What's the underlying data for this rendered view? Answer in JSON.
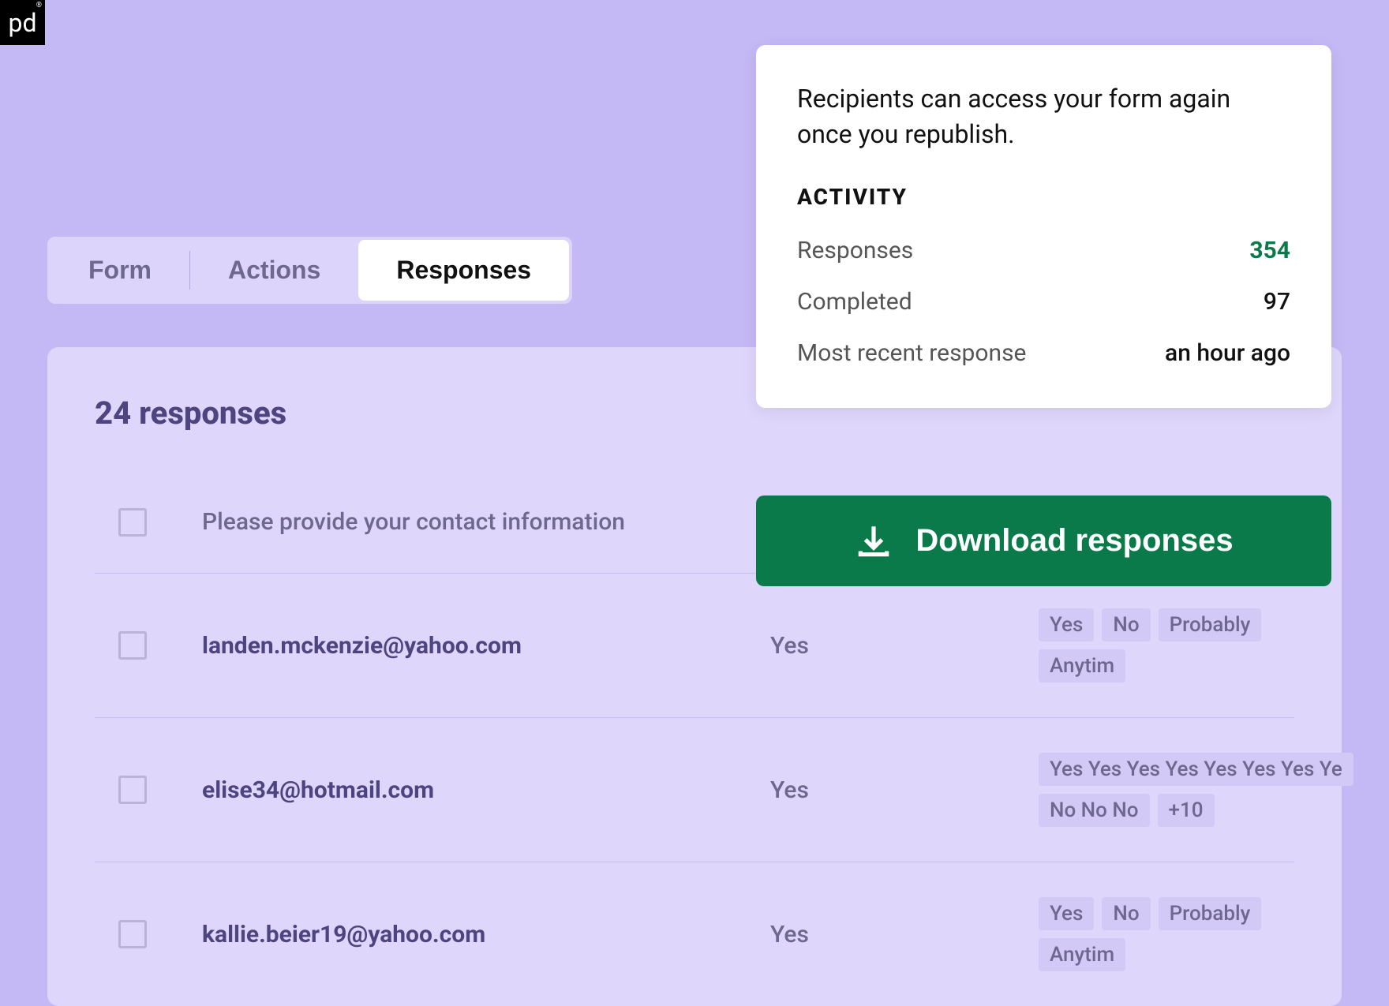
{
  "logo": "pd",
  "tabs": {
    "form": "Form",
    "actions": "Actions",
    "responses": "Responses"
  },
  "content": {
    "title": "24 responses",
    "header_text": "Please provide your contact information",
    "rows": [
      {
        "email": "landen.mckenzie@yahoo.com",
        "answer": "Yes",
        "tags": [
          "Yes",
          "No",
          "Probably",
          "Anytim"
        ]
      },
      {
        "email": "elise34@hotmail.com",
        "answer": "Yes",
        "tags": [
          "Yes Yes Yes Yes Yes Yes Yes Ye",
          "No No No",
          "+10"
        ]
      },
      {
        "email": "kallie.beier19@yahoo.com",
        "answer": "Yes",
        "tags": [
          "Yes",
          "No",
          "Probably",
          "Anytim"
        ]
      }
    ]
  },
  "activity_card": {
    "description": "Recipients can access your form again once you republish.",
    "heading": "ACTIVITY",
    "stats": [
      {
        "label": "Responses",
        "value": "354",
        "green": true
      },
      {
        "label": "Completed",
        "value": "97",
        "green": false
      },
      {
        "label": "Most recent response",
        "value": "an hour ago",
        "green": false
      }
    ]
  },
  "download_button": "Download responses"
}
